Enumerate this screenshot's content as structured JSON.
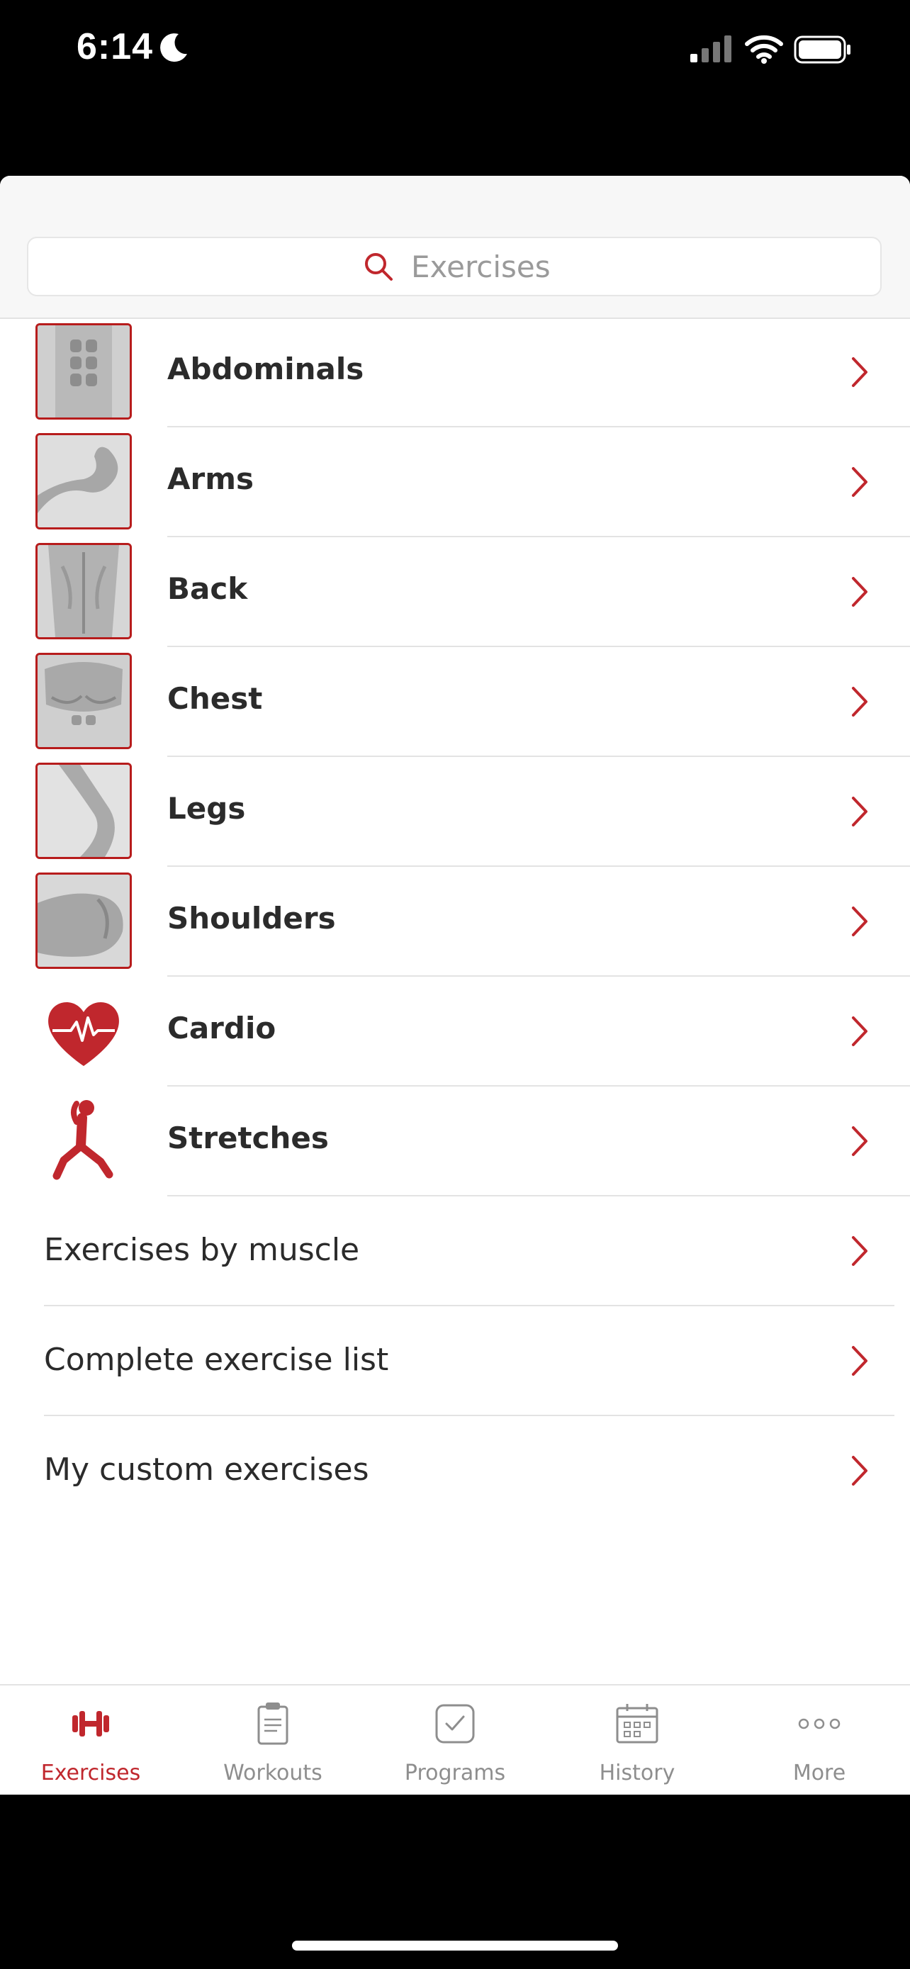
{
  "status_bar": {
    "time": "6:14"
  },
  "colors": {
    "accent": "#c0272d",
    "separator": "#e3e3e3",
    "text": "#2b2b2b",
    "inactive": "#8e8e8e"
  },
  "search": {
    "placeholder": "Exercises",
    "value": ""
  },
  "categories": [
    {
      "label": "Abdominals",
      "icon": "abdominals-photo"
    },
    {
      "label": "Arms",
      "icon": "arms-photo"
    },
    {
      "label": "Back",
      "icon": "back-photo"
    },
    {
      "label": "Chest",
      "icon": "chest-photo"
    },
    {
      "label": "Legs",
      "icon": "legs-photo"
    },
    {
      "label": "Shoulders",
      "icon": "shoulders-photo"
    },
    {
      "label": "Cardio",
      "icon": "heart-pulse-icon"
    },
    {
      "label": "Stretches",
      "icon": "stretching-person-icon"
    }
  ],
  "links": [
    {
      "label": "Exercises by muscle"
    },
    {
      "label": "Complete exercise list"
    },
    {
      "label": "My custom exercises"
    }
  ],
  "tabbar": {
    "tabs": [
      {
        "label": "Exercises",
        "icon": "dumbbell-icon",
        "active": true
      },
      {
        "label": "Workouts",
        "icon": "clipboard-icon",
        "active": false
      },
      {
        "label": "Programs",
        "icon": "checkbox-icon",
        "active": false
      },
      {
        "label": "History",
        "icon": "calendar-icon",
        "active": false
      },
      {
        "label": "More",
        "icon": "more-dots-icon",
        "active": false
      }
    ]
  }
}
